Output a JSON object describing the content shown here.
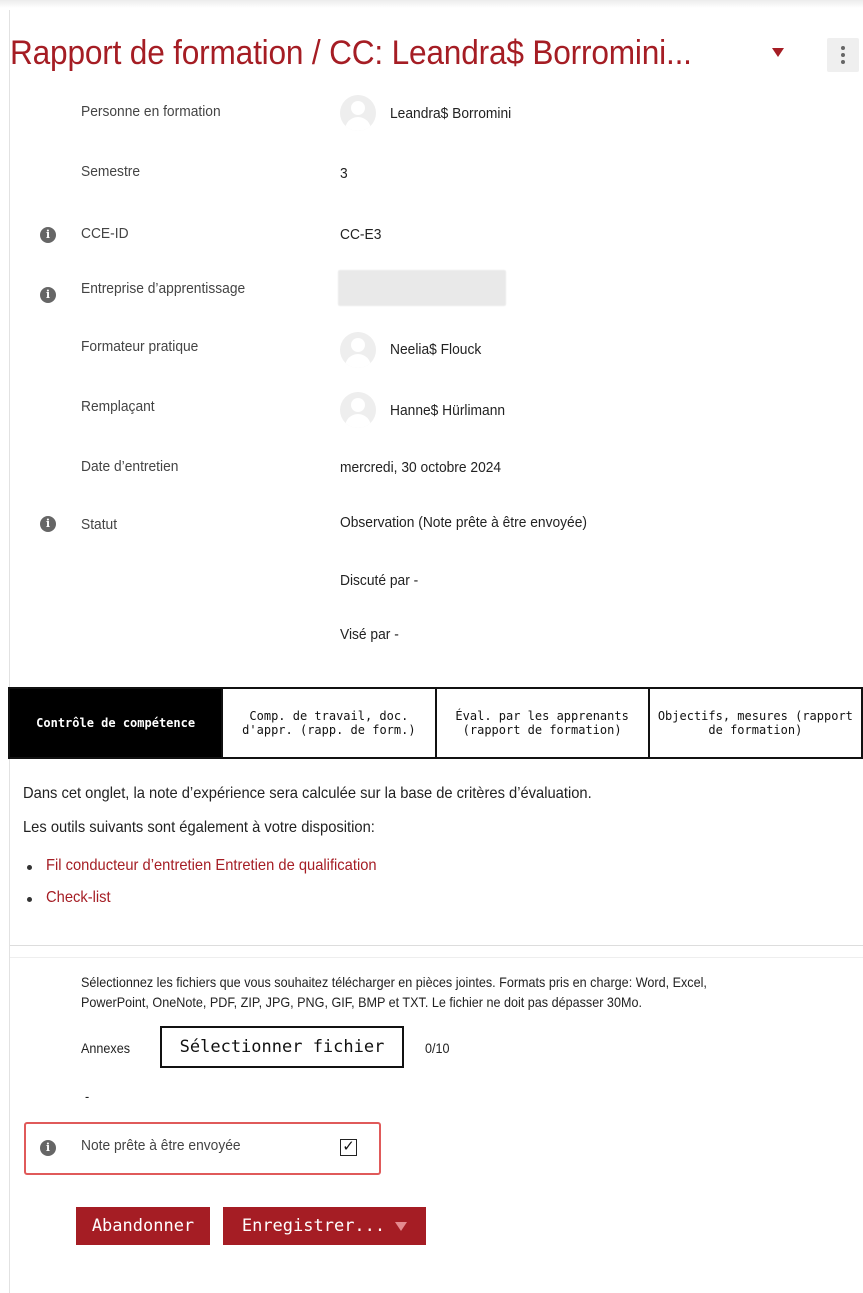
{
  "header": {
    "title": "Rapport de formation / CC: Leandra$ Borromini..."
  },
  "fields": {
    "trainee_label": "Personne en formation",
    "trainee_value": "Leandra$ Borromini",
    "semester_label": "Semestre",
    "semester_value": "3",
    "cce_label": "CCE-ID",
    "cce_value": "CC-E3",
    "company_label": "Entreprise d’apprentissage",
    "trainer_label": "Formateur pratique",
    "trainer_value": "Neelia$ Flouck",
    "deputy_label": "Remplaçant",
    "deputy_value": "Hanne$ Hürlimann",
    "date_label": "Date d’entretien",
    "date_value": "mercredi, 30 octobre 2024",
    "status_label": "Statut",
    "status_value": "Observation (Note prête à être envoyée)",
    "discussed_by": "Discuté par -",
    "signed_by": "Visé par -"
  },
  "tabs": [
    {
      "label": "Contrôle de compétence",
      "active": true
    },
    {
      "label": "Comp. de travail, doc. d'appr. (rapp. de form.)",
      "active": false
    },
    {
      "label": "Éval. par les apprenants (rapport de formation)",
      "active": false
    },
    {
      "label": "Objectifs, mesures (rapport de formation)",
      "active": false
    }
  ],
  "content": {
    "intro": "Dans cet onglet, la note d’expérience sera calculée sur la base de critères d’évaluation.",
    "tools_intro": "Les outils suivants sont également à votre disposition:",
    "links": [
      "Fil conducteur d’entretien Entretien de qualification",
      "Check-list"
    ]
  },
  "attachments": {
    "instructions_line1": "Sélectionnez les fichiers que vous souhaitez télécharger en pièces jointes. Formats pris en charge: Word, Excel,",
    "instructions_line2": "PowerPoint, OneNote, PDF, ZIP, JPG, PNG, GIF, BMP et TXT. Le fichier ne doit pas dépasser 30Mo.",
    "label": "Annexes",
    "select_button": "Sélectionner fichier",
    "count": "0/10",
    "list_placeholder": "-"
  },
  "ready": {
    "label": "Note prête à être envoyée",
    "checked": true
  },
  "actions": {
    "cancel": "Abandonner",
    "save": "Enregistrer..."
  },
  "colors": {
    "brand": "#a51d24",
    "highlight": "#e05a5a"
  }
}
